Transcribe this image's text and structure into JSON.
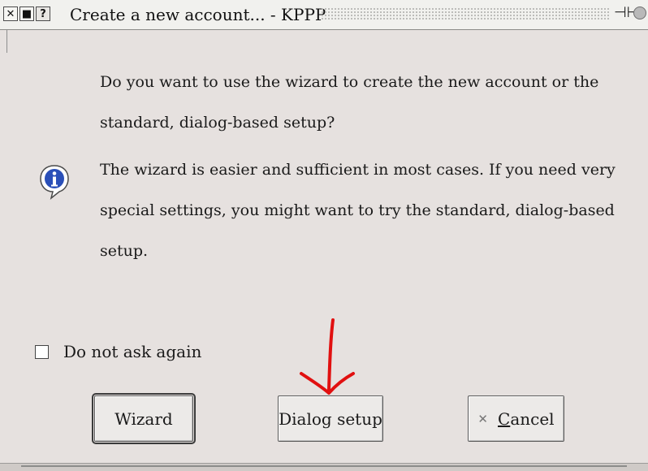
{
  "window": {
    "title": "Create a new account... - KPPP",
    "buttons": {
      "close": "✕",
      "maximize": "■",
      "help": "?"
    },
    "icons": [
      "close-icon",
      "maximize-icon",
      "help-icon",
      "pin-icon",
      "settings-icon"
    ]
  },
  "dialog": {
    "question": "Do you want to use the wizard to create the new account or the standard, dialog-based setup?",
    "explanation": "The wizard is easier and sufficient in most cases. If you need very special settings, you might want to try the standard, dialog-based setup.",
    "icon": "info-icon",
    "checkbox_label": "Do not ask again",
    "checkbox_checked": false
  },
  "buttons": {
    "wizard": "Wizard",
    "dialog_setup": "Dialog setup",
    "cancel": "Cancel",
    "cancel_mnemonic": "C",
    "cancel_rest": "ancel"
  },
  "annotation": {
    "color": "#e11010",
    "icon": "arrow-down-icon"
  }
}
